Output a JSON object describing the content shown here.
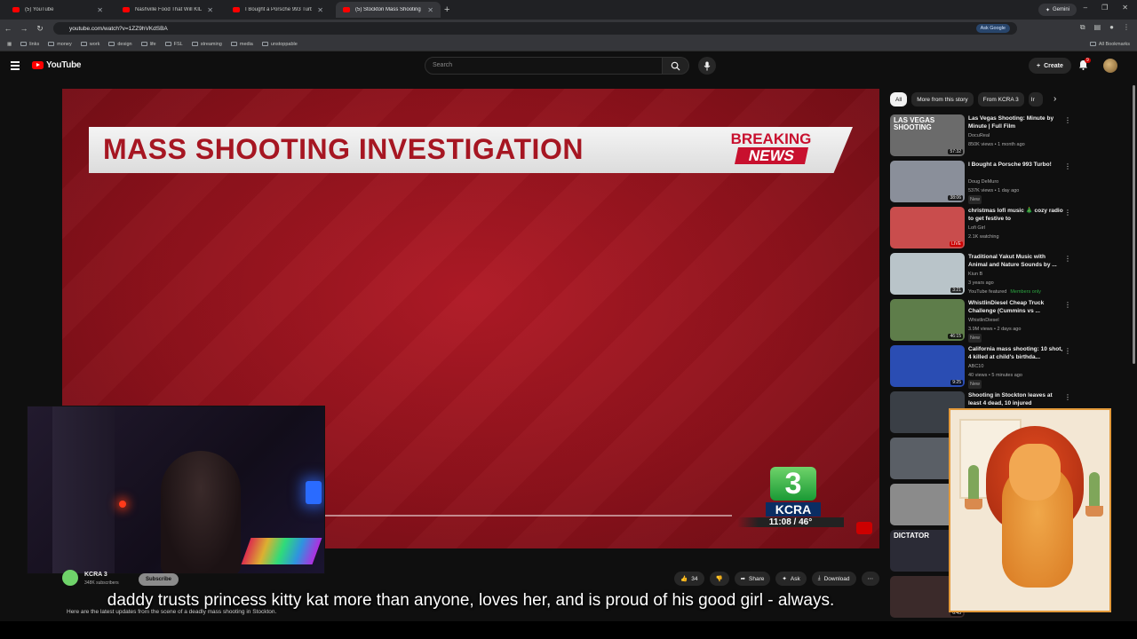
{
  "browser": {
    "tabs": [
      {
        "title": "(5) YouTube"
      },
      {
        "title": "Nashville Food That Will KILL Y"
      },
      {
        "title": "I Bought a Porsche 993 Turbo!"
      },
      {
        "title": "(5) Stockton Mass Shooting Co",
        "active": true
      }
    ],
    "gemini": "Gemini",
    "url": "youtube.com/watch?v=1ZZ9hVKdSBA",
    "ask_google": "Ask Google",
    "bookmarks": [
      "links",
      "money",
      "work",
      "design",
      "life",
      "FSL",
      "streaming",
      "media",
      "unstoppable"
    ],
    "all_bookmarks": "All Bookmarks"
  },
  "youtube": {
    "logo": "YouTube",
    "search_placeholder": "Search",
    "create": "Create",
    "notif_count": "9"
  },
  "video": {
    "lower_third": "MASS SHOOTING INVESTIGATION",
    "breaking_1": "BREAKING",
    "breaking_2": "NEWS",
    "station_number": "3",
    "station_name": "KCRA",
    "time_temp": "11:08 / 46°"
  },
  "channel": {
    "name": "KCRA 3",
    "subs": "348K subscribers",
    "subscribe": "Subscribe",
    "likes": "34",
    "share": "Share",
    "ask": "Ask",
    "download": "Download",
    "description": "Here are the latest updates from the scene of a deadly mass shooting in Stockton."
  },
  "caption": "daddy trusts princess kitty kat more than anyone, loves her, and is proud of his good girl - always.",
  "sidebar": {
    "chips": [
      "All",
      "More from this story",
      "From KCRA 3",
      "Ir"
    ],
    "recs": [
      {
        "title": "Las Vegas Shooting: Minute by Minute | Full Film",
        "channel": "DocuReal",
        "meta": "850K views • 1 month ago",
        "badge": "",
        "duration": "57:32",
        "thumb": "#6b6b6b",
        "thumb_text": "LAS VEGAS SHOOTING"
      },
      {
        "title": "I Bought a Porsche 993 Turbo!",
        "channel": "Doug DeMuro",
        "meta": "537K views • 1 day ago",
        "badge": "New",
        "duration": "38:06",
        "thumb": "#8a8f9a",
        "thumb_text": ""
      },
      {
        "title": "christmas lofi music 🎄 cozy radio to get festive to",
        "channel": "Lofi Girl",
        "meta": "2.1K watching",
        "badge": "",
        "duration": "LIVE",
        "thumb": "#c94d4d",
        "thumb_text": ""
      },
      {
        "title": "Traditional Yakut Music with Animal and Nature Sounds by ...",
        "channel": "Kiun B",
        "meta": "3 years ago",
        "badge": "",
        "extra": "YouTube featured",
        "members": "Members only",
        "duration": "3:21",
        "thumb": "#b9c4c9",
        "thumb_text": ""
      },
      {
        "title": "WhistlinDiesel Cheap Truck Challenge (Cummins vs ...",
        "channel": "WhistlinDiesel",
        "meta": "3.9M views • 2 days ago",
        "badge": "New",
        "duration": "46:15",
        "thumb": "#5e7d4a",
        "thumb_text": ""
      },
      {
        "title": "California mass shooting: 10 shot, 4 killed at child's birthda...",
        "channel": "ABC10",
        "meta": "40 views • 5 minutes ago",
        "badge": "New",
        "duration": "9:25",
        "thumb": "#2a4db3",
        "thumb_text": ""
      },
      {
        "title": "Shooting in Stockton leaves at least 4 dead, 10 injured",
        "channel": "",
        "meta": "",
        "badge": "",
        "duration": "",
        "thumb": "#3a3f46",
        "thumb_text": ""
      },
      {
        "title": "",
        "channel": "",
        "meta": "",
        "badge": "",
        "duration": "",
        "thumb": "#5a5f66",
        "thumb_text": ""
      },
      {
        "title": "",
        "channel": "",
        "meta": "",
        "badge": "",
        "duration": "",
        "thumb": "#8b8b8b",
        "thumb_text": ""
      },
      {
        "title": "",
        "channel": "",
        "meta": "",
        "badge": "",
        "duration": "",
        "thumb": "#2b2b36",
        "thumb_text": "DICTATOR"
      },
      {
        "title": "",
        "channel": "",
        "meta": "",
        "badge": "",
        "duration": "6:43",
        "thumb": "#3b2a2a",
        "thumb_text": ""
      }
    ]
  }
}
